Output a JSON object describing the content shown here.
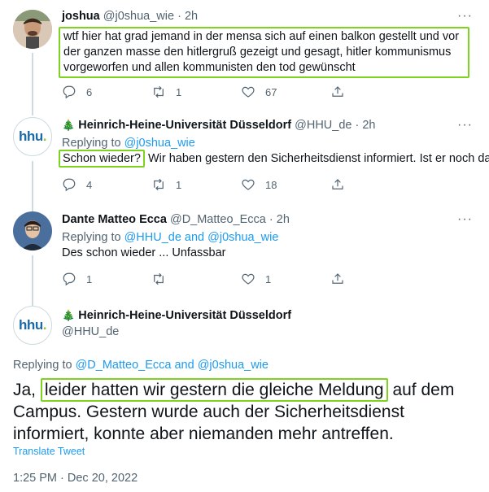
{
  "tweets": [
    {
      "name": "joshua",
      "handle": "@j0shua_wie",
      "time": "2h",
      "text": "wtf hier hat grad jemand in der mensa sich auf einen balkon gestellt und vor der ganzen masse den hitlergruß gezeigt und gesagt, hitler kommunismus vorgeworfen und allen kommunisten den tod gewünscht",
      "replies": "6",
      "retweets": "1",
      "likes": "67"
    },
    {
      "name": "Heinrich-Heine-Universität Düsseldorf",
      "handle": "@HHU_de",
      "time": "2h",
      "replying_prefix": "Replying to",
      "replying_to": "@j0shua_wie",
      "text_highlight": "Schon wieder?",
      "text_rest": "Wir haben gestern den Sicherheitsdienst informiert. Ist er noch da?",
      "replies": "4",
      "retweets": "1",
      "likes": "18"
    },
    {
      "name": "Dante Matteo Ecca",
      "handle": "@D_Matteo_Ecca",
      "time": "2h",
      "replying_prefix": "Replying to",
      "replying_to": "@HHU_de and @j0shua_wie",
      "text": "Des schon wieder ... Unfassbar",
      "replies": "1",
      "retweets": "",
      "likes": "1"
    }
  ],
  "main_tweet": {
    "name": "Heinrich-Heine-Universität Düsseldorf",
    "handle": "@HHU_de",
    "replying_prefix": "Replying to",
    "replying_to": "@D_Matteo_Ecca and @j0shua_wie",
    "text_pre": "Ja,",
    "text_highlight": "leider hatten wir gestern die gleiche Meldung",
    "text_post": "auf dem Campus. Gestern wurde auch der Sicherheitsdienst informiert, konnte aber niemanden mehr antreffen.",
    "translate": "Translate Tweet",
    "timestamp": "1:25 PM · Dec 20, 2022"
  },
  "misc": {
    "dot": "·",
    "more": "···",
    "tree_emoji": "🎄",
    "hhu_logo_text": "hhu",
    "hhu_logo_dot": "."
  },
  "colors": {
    "link": "#1d9bf0",
    "secondary_text": "#536471",
    "highlight_box": "#7ed321",
    "thread_line": "#cfd9de"
  }
}
